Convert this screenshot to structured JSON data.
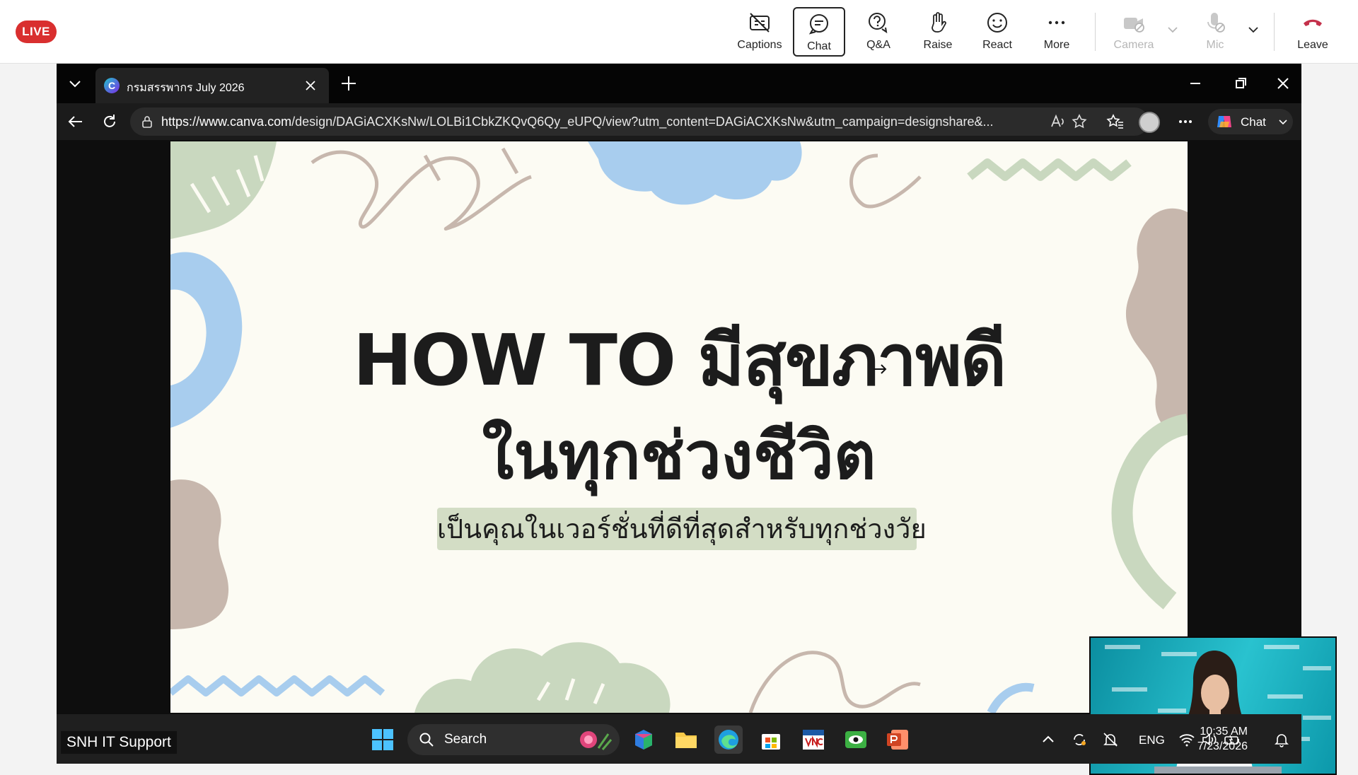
{
  "teams": {
    "live_label": "LIVE",
    "buttons": [
      {
        "label": "Captions",
        "icon": "captions-off-icon"
      },
      {
        "label": "Chat",
        "icon": "chat-icon",
        "active": true
      },
      {
        "label": "Q&A",
        "icon": "qa-icon"
      },
      {
        "label": "Raise",
        "icon": "raise-hand-icon"
      },
      {
        "label": "React",
        "icon": "smiley-icon"
      },
      {
        "label": "More",
        "icon": "more-icon"
      },
      {
        "label": "Camera",
        "icon": "camera-off-icon",
        "disabled": true
      },
      {
        "label": "Mic",
        "icon": "mic-off-icon",
        "disabled": true
      },
      {
        "label": "Leave",
        "icon": "hang-up-icon",
        "color": "#c4314b"
      }
    ]
  },
  "browser": {
    "tab_title": "กรมสรรพากร July 2026",
    "url_domain": "https://www.canva.com",
    "url_rest": "/design/DAGiACXKsNw/LOLBi1CbkZKQvQ6Qy_eUPQ/view?utm_content=DAGiACXKsNw&utm_campaign=designshare&...",
    "copilot_label": "Chat"
  },
  "slide": {
    "title_line1": "HOW TO มีสุขภาพดี",
    "title_line2": "ในทุกช่วงชีวิต",
    "subtitle": "เป็นคุณในเวอร์ชั่นที่ดีที่สุดสำหรับทุกช่วงวัย",
    "colors": {
      "background": "#fcfbf3",
      "green": "#c9d8bf",
      "blue": "#a8cdee",
      "brown": "#c7b7ad",
      "highlight": "#d3ddc5"
    }
  },
  "taskbar": {
    "caption_label": "SNH IT Support",
    "search_label": "Search",
    "language": "ENG",
    "time": "10:35 AM",
    "date": "7/23/2026"
  }
}
